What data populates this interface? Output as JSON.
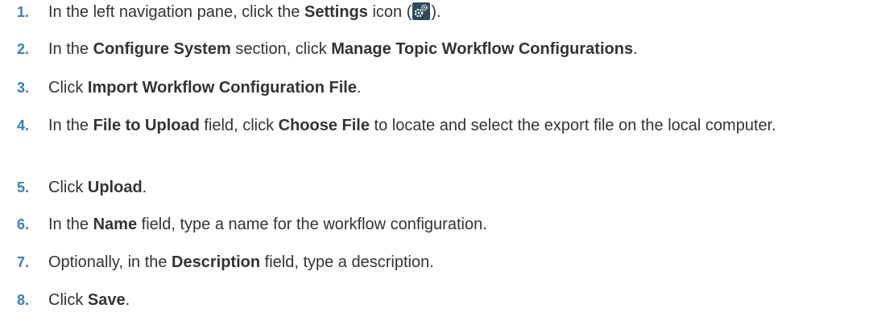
{
  "steps": [
    {
      "number": "1.",
      "parts": [
        "In the left navigation pane, click the ",
        "Settings",
        " icon (",
        ")."
      ],
      "icon": "settings-gear-icon"
    },
    {
      "number": "2.",
      "parts": [
        "In the ",
        "Configure System",
        " section, click ",
        "Manage Topic Workflow Configurations",
        "."
      ]
    },
    {
      "number": "3.",
      "parts": [
        "Click ",
        "Import Workflow Configuration File",
        "."
      ]
    },
    {
      "number": "4.",
      "parts": [
        "In the ",
        "File to Upload",
        " field, click ",
        "Choose File",
        " to locate and select the export file on the local computer."
      ]
    },
    {
      "number": "5.",
      "parts": [
        "Click ",
        "Upload",
        "."
      ]
    },
    {
      "number": "6.",
      "parts": [
        "In the ",
        "Name",
        " field, type a name for the workflow configuration."
      ]
    },
    {
      "number": "7.",
      "parts": [
        "Optionally, in the ",
        "Description",
        " field, type a description."
      ]
    },
    {
      "number": "8.",
      "parts": [
        "Click ",
        "Save",
        "."
      ]
    }
  ],
  "colors": {
    "step_number": "#3a7fb8",
    "text": "#333333",
    "icon_bg": "#2d4a5e"
  }
}
